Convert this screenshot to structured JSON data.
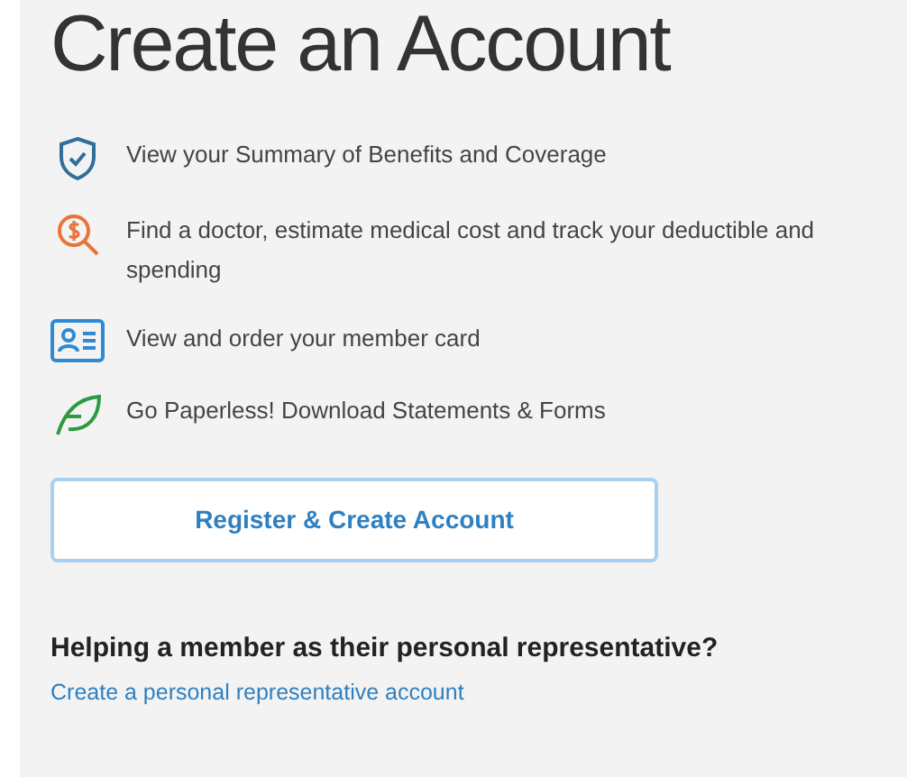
{
  "title": "Create an Account",
  "features": [
    {
      "kind": "shield",
      "text": "View your Summary of Benefits and Coverage"
    },
    {
      "kind": "cost",
      "text": "Find a doctor, estimate medical cost and track your deductible and spending"
    },
    {
      "kind": "card",
      "text": "View and order your member card"
    },
    {
      "kind": "leaf",
      "text": "Go Paperless! Download Statements & Forms"
    }
  ],
  "register_button": "Register & Create Account",
  "representative": {
    "heading": "Helping a member as their personal representative?",
    "link": "Create a personal representative account"
  }
}
